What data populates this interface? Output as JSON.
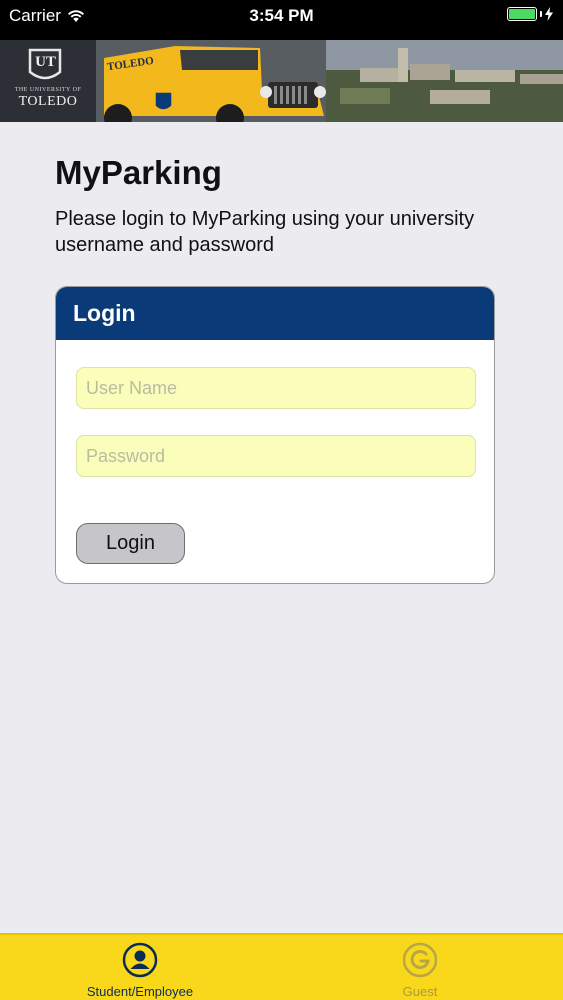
{
  "status_bar": {
    "carrier": "Carrier",
    "time": "3:54 PM",
    "battery_color": "#4cd964"
  },
  "banner": {
    "university_small": "THE UNIVERSITY OF",
    "university_name": "TOLEDO",
    "logo_letters": "UT",
    "jeep_text": "TOLEDO",
    "logo_icon": "shield-icon"
  },
  "main": {
    "title": "MyParking",
    "intro": "Please login to MyParking using your university username and password"
  },
  "login_card": {
    "header": "Login",
    "header_color": "#0a3a78",
    "username_placeholder": "User Name",
    "password_placeholder": "Password",
    "button_label": "Login",
    "field_color": "#fbfdbb"
  },
  "tab_bar": {
    "background": "#f9d81c",
    "tabs": [
      {
        "label": "Student/Employee",
        "icon": "person-icon",
        "selected": true
      },
      {
        "label": "Guest",
        "icon": "letter-g-icon",
        "selected": false
      }
    ]
  }
}
